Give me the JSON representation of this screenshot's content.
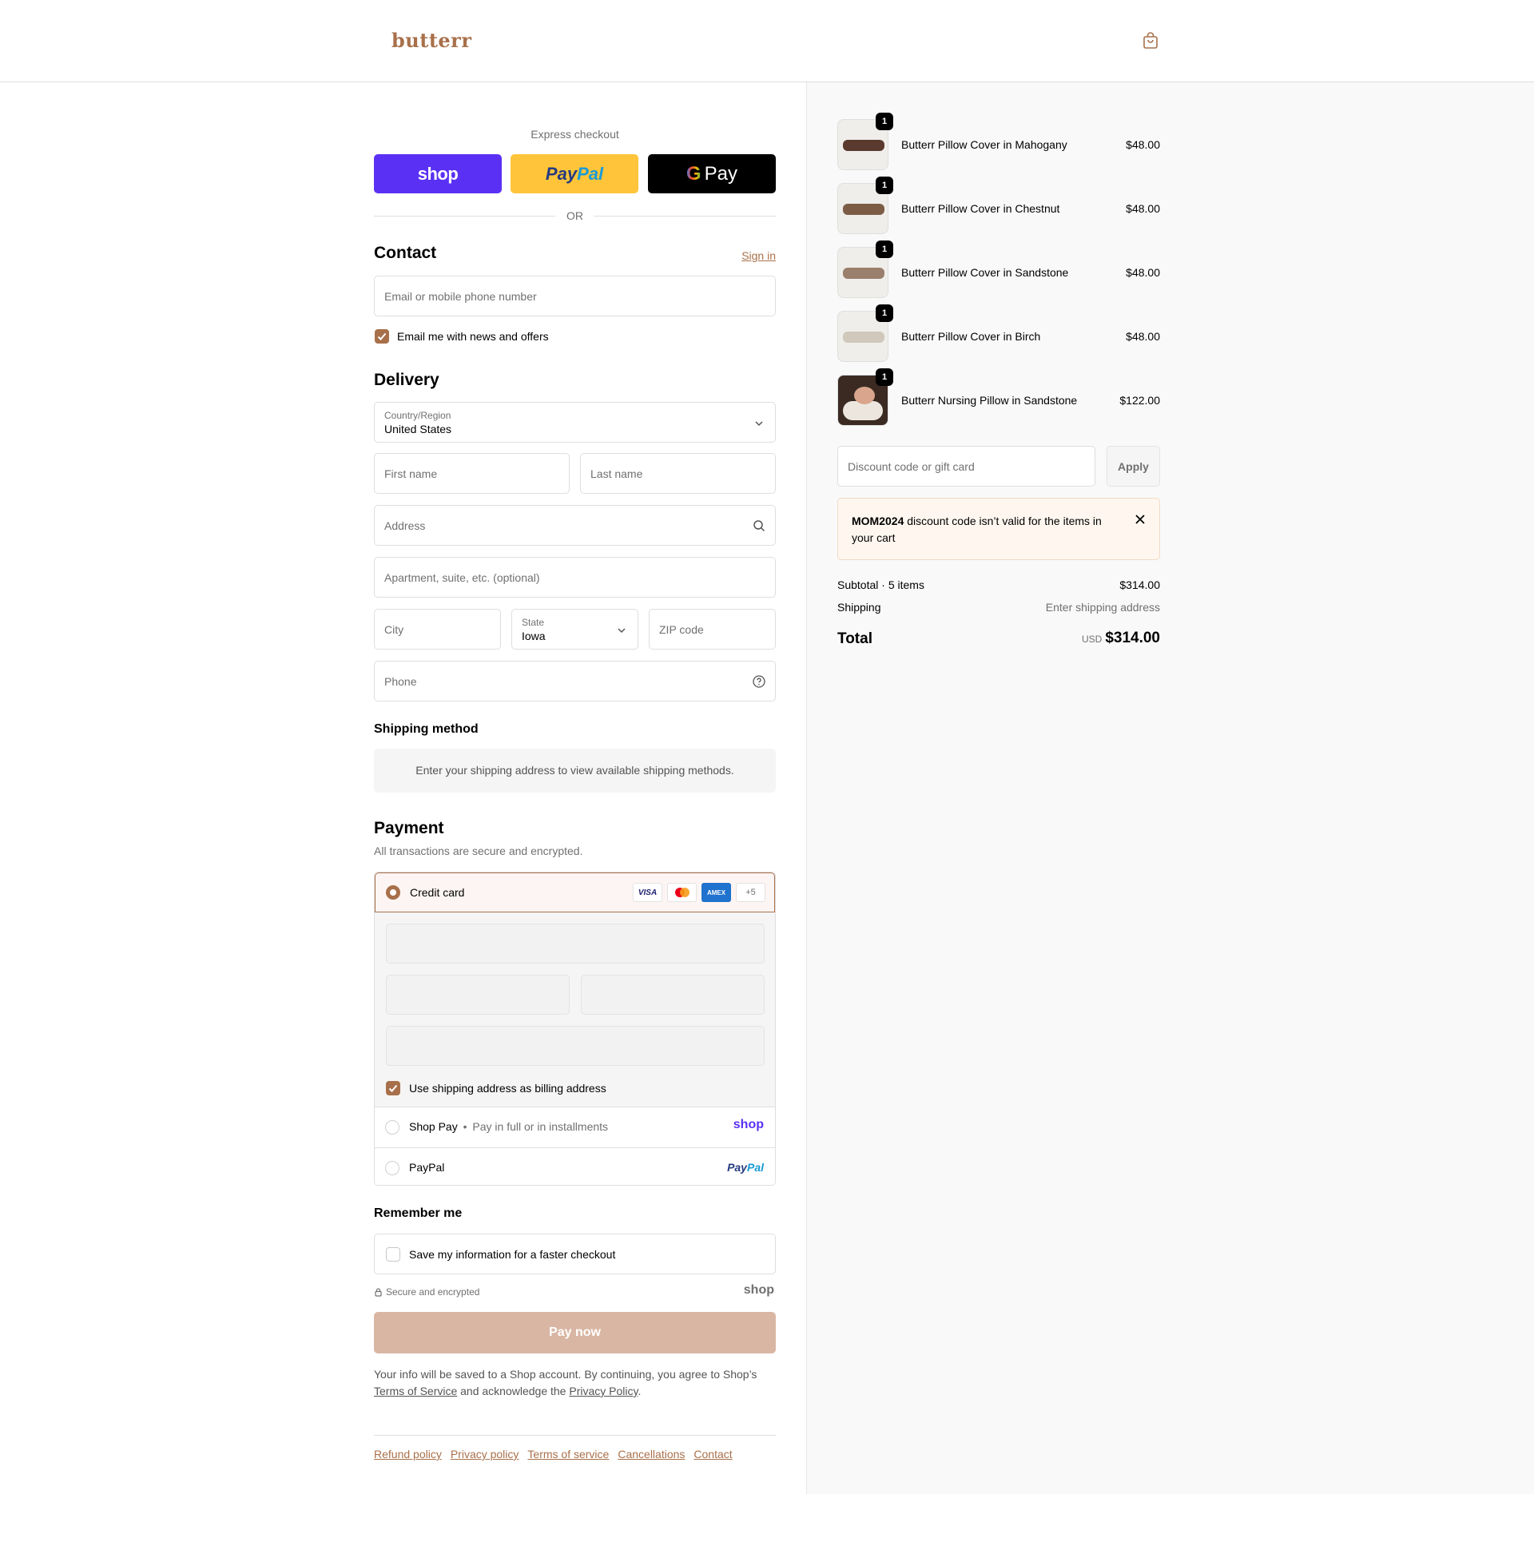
{
  "header": {
    "logo": "butterr",
    "cart_icon": "shopping-bag-icon"
  },
  "express": {
    "title": "Express checkout",
    "shop_label": "shop",
    "paypal_part1": "Pay",
    "paypal_part2": "Pal",
    "gpay_g": "G",
    "gpay_label": "Pay",
    "or_label": "OR"
  },
  "contact": {
    "title": "Contact",
    "sign_in": "Sign in",
    "email_placeholder": "Email or mobile phone number",
    "news_label": "Email me with news and offers",
    "news_checked": true
  },
  "delivery": {
    "title": "Delivery",
    "country_label": "Country/Region",
    "country_value": "United States",
    "first_name": "First name",
    "last_name": "Last name",
    "address": "Address",
    "apartment": "Apartment, suite, etc. (optional)",
    "city": "City",
    "state_label": "State",
    "state_value": "Iowa",
    "zip": "ZIP code",
    "phone": "Phone"
  },
  "shipping": {
    "title": "Shipping method",
    "message": "Enter your shipping address to view available shipping methods."
  },
  "payment": {
    "title": "Payment",
    "subtitle": "All transactions are secure and encrypted.",
    "credit_card": "Credit card",
    "cards": [
      "VISA",
      "MC",
      "AMEX",
      "+5"
    ],
    "billing_label": "Use shipping address as billing address",
    "billing_checked": true,
    "shop_pay": "Shop Pay",
    "shop_pay_sep": "•",
    "shop_pay_desc": "Pay in full or in installments",
    "shop_pay_logo": "shop",
    "paypal": "PayPal",
    "paypal_logo_1": "Pay",
    "paypal_logo_2": "Pal"
  },
  "remember": {
    "title": "Remember me",
    "save_label": "Save my information for a faster checkout",
    "secure": "Secure and encrypted",
    "shop_logo": "shop"
  },
  "pay_now": "Pay now",
  "legal": {
    "text1": "Your info will be saved to a Shop account. By continuing, you agree to Shop’s",
    "tos": "Terms of Service",
    "text2": " and acknowledge the ",
    "privacy": "Privacy Policy",
    "text3": "."
  },
  "footer": [
    "Refund policy",
    "Privacy policy",
    "Terms of service",
    "Cancellations",
    "Contact"
  ],
  "summary": {
    "items": [
      {
        "name": "Butterr Pillow Cover in Mahogany",
        "price": "$48.00",
        "qty": "1",
        "color": "#5a3a2e"
      },
      {
        "name": "Butterr Pillow Cover in Chestnut",
        "price": "$48.00",
        "qty": "1",
        "color": "#7d5c46"
      },
      {
        "name": "Butterr Pillow Cover in Sandstone",
        "price": "$48.00",
        "qty": "1",
        "color": "#9a7f6c"
      },
      {
        "name": "Butterr Pillow Cover in Birch",
        "price": "$48.00",
        "qty": "1",
        "color": "#cfc8bb"
      },
      {
        "name": "Butterr Nursing Pillow in Sandstone",
        "price": "$122.00",
        "qty": "1",
        "color": "#a58c7a"
      }
    ],
    "discount_placeholder": "Discount code or gift card",
    "apply": "Apply",
    "notice_code": "MOM2024",
    "notice_text": " discount code isn’t valid for the items in your cart",
    "subtotal_label": "Subtotal · 5 items",
    "subtotal_value": "$314.00",
    "shipping_label": "Shipping",
    "shipping_value": "Enter shipping address",
    "total_label": "Total",
    "currency": "USD",
    "total_value": "$314.00"
  },
  "colors": {
    "accent": "#a8704a",
    "shop_purple": "#5a31f4",
    "paypal_yellow": "#ffc439"
  }
}
